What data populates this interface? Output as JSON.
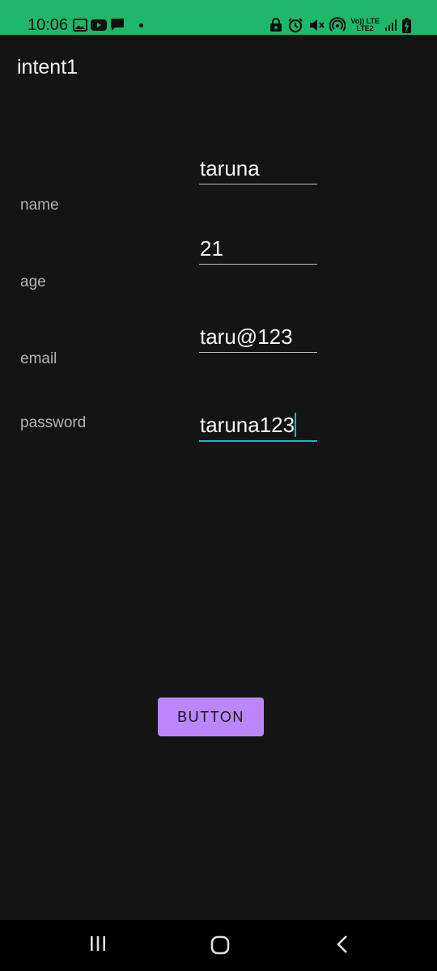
{
  "status_bar": {
    "time": "10:06",
    "left_icons": [
      "gallery-icon",
      "youtube-icon",
      "chat-icon",
      "notification-dot"
    ],
    "right_icons": [
      "lock-icon",
      "alarm-icon",
      "mute-icon",
      "hotspot-icon",
      "volte-lte-icon",
      "signal-icon",
      "battery-charging-icon"
    ],
    "volte_label": "Vo)) LTE",
    "lte2_label": "LTE2",
    "background_color": "#1fb86a"
  },
  "app_bar": {
    "title": "intent1"
  },
  "form": {
    "fields": [
      {
        "label": "name",
        "value": "taruna"
      },
      {
        "label": "age",
        "value": "21"
      },
      {
        "label": "email",
        "value": "taru@123"
      },
      {
        "label": "password",
        "value": "taruna123"
      }
    ],
    "focused_field": "password",
    "accent_color": "#03c4b4"
  },
  "button": {
    "label": "BUTTON",
    "color": "#bb86fc"
  },
  "nav_bar": {
    "items": [
      "recent-apps-icon",
      "home-icon",
      "back-icon"
    ]
  }
}
